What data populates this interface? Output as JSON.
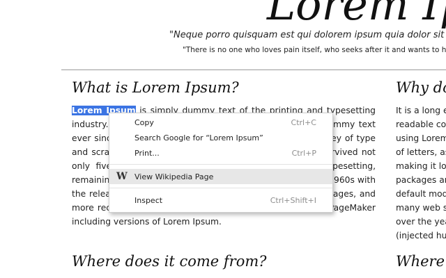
{
  "header": {
    "title": "Lorem Ipsum",
    "quote": "\"Neque porro quisquam est qui dolorem ipsum quia dolor sit amet, consectetur, adipisci velit...\"",
    "quote_translation": "\"There is no one who loves pain itself, who seeks after it and wants to have it, simply because it is pain...\""
  },
  "left_column": {
    "heading": "What is Lorem Ipsum?",
    "paragraph_selected": "Lorem Ipsum",
    "paragraph_rest": " is simply dummy text of the printing and typesetting industry. Lorem Ipsum has been the industry's standard dummy text ever since the 1500s, when an unknown printer took a galley of type and scrambled it to make a type specimen book. It has survived not only five centuries, but also the leap into electronic typesetting, remaining essentially unchanged. It was popularised in the 1960s with the release of Letraset sheets containing Lorem Ipsum passages, and more recently with desktop publishing software like Aldus PageMaker including versions of Lorem Ipsum.",
    "heading2": "Where does it come from?"
  },
  "right_column": {
    "heading": "Why do we use it?",
    "lines": [
      "It is a long established fact that a reader will be distracted by the",
      "readable content of a page when looking at its layout. The point of",
      "using Lorem Ipsum is that it has a more-or-less normal distribution",
      "of letters, as opposed to using 'Content here, content here',",
      "making it look like readable English. Many desktop publishing",
      "packages and web page editors now use Lorem Ipsum as their",
      "default model text, and a search for 'lorem ipsum' will uncover",
      "many web sites still in their infancy. Various versions have evolved",
      "over the years, sometimes by accident, sometimes on purpose",
      "(injected humour and the like)."
    ],
    "heading2": "Where can I get some?"
  },
  "context_menu": {
    "copy": {
      "label": "Copy",
      "shortcut": "Ctrl+C"
    },
    "search": {
      "label": "Search Google for “Lorem Ipsum”"
    },
    "print": {
      "label": "Print...",
      "shortcut": "Ctrl+P"
    },
    "wikipedia": {
      "label": "View Wikipedia Page",
      "icon": "W"
    },
    "inspect": {
      "label": "Inspect",
      "shortcut": "Ctrl+Shift+I"
    }
  },
  "colors": {
    "selection": "#3b74e3",
    "menu_hover": "#e7e7e7"
  }
}
